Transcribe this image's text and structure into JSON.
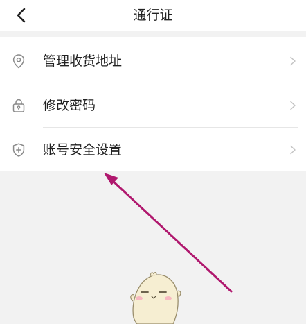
{
  "header": {
    "title": "通行证",
    "back_icon": "chevron-left-icon"
  },
  "menu": {
    "items": [
      {
        "label": "管理收货地址",
        "icon": "location-pin-icon"
      },
      {
        "label": "修改密码",
        "icon": "lock-icon"
      },
      {
        "label": "账号安全设置",
        "icon": "shield-plus-icon"
      }
    ],
    "chevron_icon": "chevron-right-icon"
  },
  "annotation": {
    "arrow_color": "#b0186e"
  },
  "mascot": {
    "icon": "chick-mascot-icon"
  }
}
